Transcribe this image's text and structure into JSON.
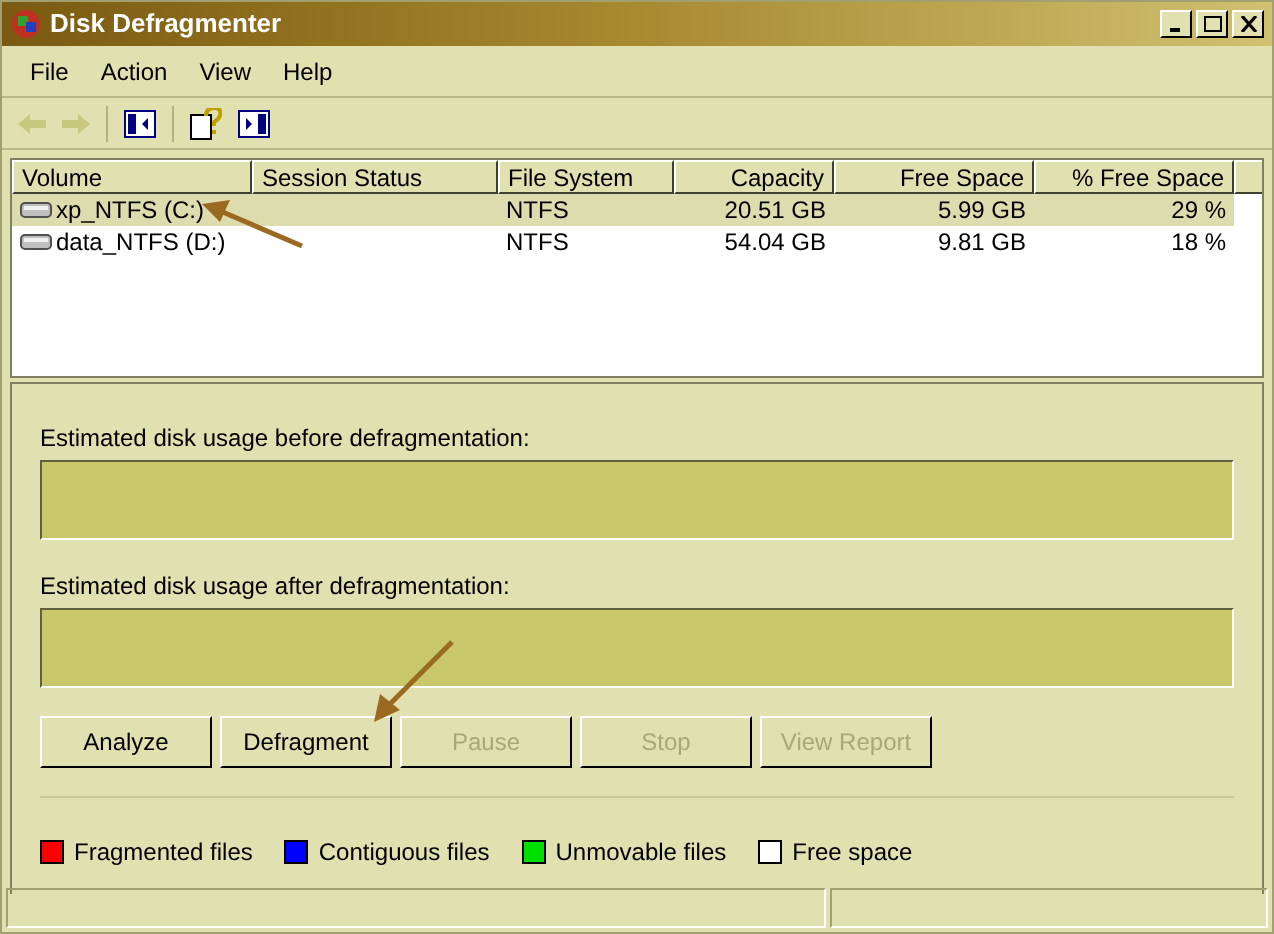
{
  "window": {
    "title": "Disk Defragmenter"
  },
  "menu": [
    "File",
    "Action",
    "View",
    "Help"
  ],
  "volumes": {
    "columns": [
      "Volume",
      "Session Status",
      "File System",
      "Capacity",
      "Free Space",
      "% Free Space"
    ],
    "rows": [
      {
        "volume": "xp_NTFS (C:)",
        "session_status": "",
        "file_system": "NTFS",
        "capacity": "20.51 GB",
        "free_space": "5.99 GB",
        "percent_free": "29 %",
        "selected": true
      },
      {
        "volume": "data_NTFS (D:)",
        "session_status": "",
        "file_system": "NTFS",
        "capacity": "54.04 GB",
        "free_space": "9.81 GB",
        "percent_free": "18 %",
        "selected": false
      }
    ]
  },
  "usage": [
    {
      "label": "Estimated disk usage before defragmentation:"
    },
    {
      "label": "Estimated disk usage after defragmentation:"
    }
  ],
  "buttons": [
    {
      "label": "Analyze",
      "disabled": false
    },
    {
      "label": "Defragment",
      "disabled": false
    },
    {
      "label": "Pause",
      "disabled": true
    },
    {
      "label": "Stop",
      "disabled": true
    },
    {
      "label": "View Report",
      "disabled": true
    }
  ],
  "legend": [
    {
      "label": "Fragmented files",
      "color": "#ff0000"
    },
    {
      "label": "Contiguous files",
      "color": "#0000ff"
    },
    {
      "label": "Unmovable files",
      "color": "#00e000"
    },
    {
      "label": "Free space",
      "color": "#ffffff"
    }
  ]
}
